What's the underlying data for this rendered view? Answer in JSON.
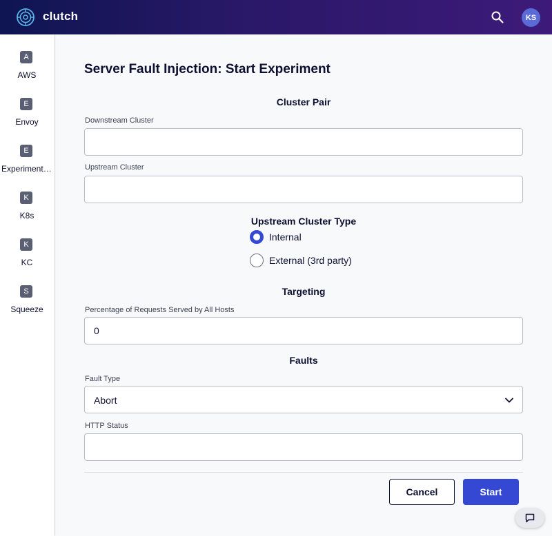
{
  "app": {
    "brand": "clutch",
    "logo_icon": "clutch-logo-icon",
    "avatar_initials": "KS",
    "colors": {
      "header_start": "#0e1552",
      "header_end": "#3d1a7a",
      "accent": "#3548d4"
    }
  },
  "sidebar": {
    "items": [
      {
        "badge": "A",
        "label": "AWS"
      },
      {
        "badge": "E",
        "label": "Envoy"
      },
      {
        "badge": "E",
        "label": "Experimentation"
      },
      {
        "badge": "K",
        "label": "K8s"
      },
      {
        "badge": "K",
        "label": "KC"
      },
      {
        "badge": "S",
        "label": "Squeeze"
      }
    ]
  },
  "form": {
    "title": "Server Fault Injection: Start Experiment",
    "cluster_pair": {
      "heading": "Cluster Pair",
      "downstream_label": "Downstream Cluster",
      "downstream_value": "",
      "upstream_label": "Upstream Cluster",
      "upstream_value": ""
    },
    "upstream_type": {
      "heading": "Upstream Cluster Type",
      "options": [
        "Internal",
        "External (3rd party)"
      ],
      "selected": "Internal"
    },
    "targeting": {
      "heading": "Targeting",
      "percentage_label": "Percentage of Requests Served by All Hosts",
      "percentage_value": "0"
    },
    "faults": {
      "heading": "Faults",
      "fault_type_label": "Fault Type",
      "fault_type_value": "Abort",
      "http_status_label": "HTTP Status",
      "http_status_value": ""
    },
    "actions": {
      "cancel_label": "Cancel",
      "start_label": "Start"
    }
  }
}
